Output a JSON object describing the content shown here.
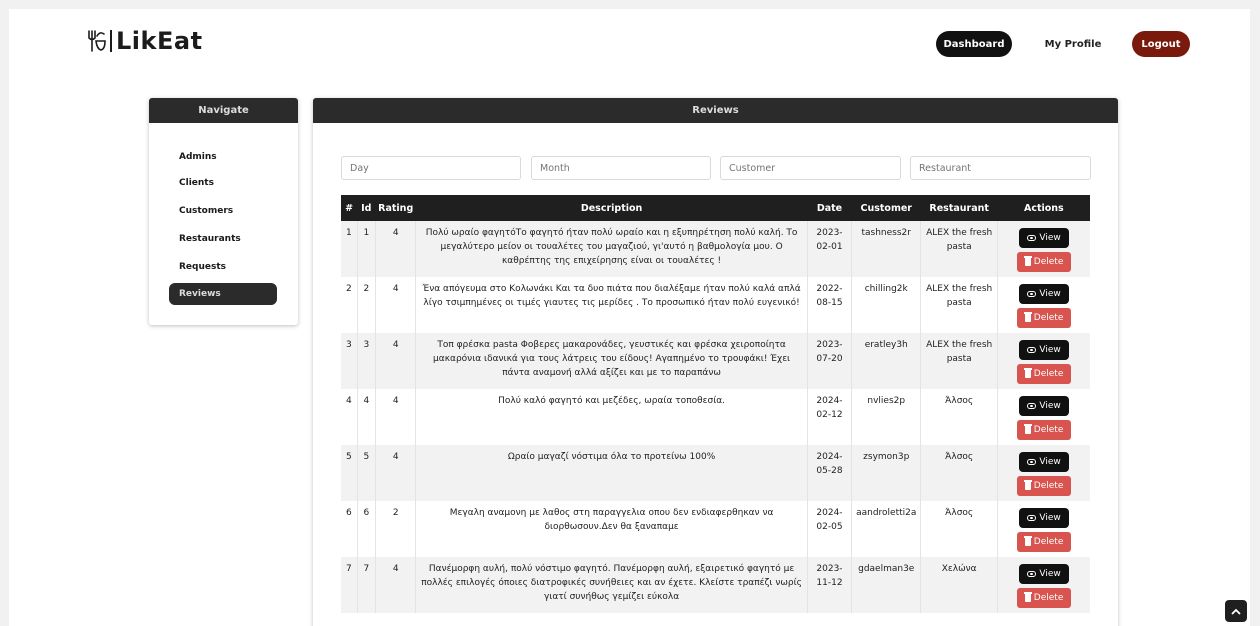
{
  "header": {
    "logo_text": "LikEat",
    "nav": {
      "dashboard": "Dashboard",
      "profile": "My Profile",
      "logout": "Logout"
    },
    "colors": {
      "dark": "#111111",
      "logout": "#7a1a0d"
    }
  },
  "sidebar": {
    "title": "Navigate",
    "items": [
      {
        "label": "Admins"
      },
      {
        "label": "Clients"
      },
      {
        "label": "Customers"
      },
      {
        "label": "Restaurants"
      },
      {
        "label": "Requests"
      },
      {
        "label": "Reviews",
        "active": true
      }
    ]
  },
  "reviews": {
    "title": "Reviews",
    "filters": {
      "day": "Day",
      "month": "Month",
      "customer": "Customer",
      "restaurant": "Restaurant"
    },
    "columns": [
      "#",
      "Id",
      "Rating",
      "Description",
      "Date",
      "Customer",
      "Restaurant",
      "Actions"
    ],
    "view_label": "View",
    "delete_label": "Delete",
    "rows": [
      {
        "n": "1",
        "id": "1",
        "rating": "4",
        "desc": "Πολύ ωραίο φαγητόΤο φαγητό ήταν πολύ ωραίο και η εξυπηρέτηση πολύ καλή. Το μεγαλύτερο μείον οι τουαλέτες του μαγαζιού, γι'αυτό η βαθμολογία μου. Ο καθρέπτης της επιχείρησης είναι οι τουαλέτες !",
        "date": "2023-02-01",
        "customer": "tashness2r",
        "restaurant": "ALEX the fresh pasta"
      },
      {
        "n": "2",
        "id": "2",
        "rating": "4",
        "desc": "Ένα απόγευμα στο Κολωνάκι Και τα δυο πιάτα που διαλέξαμε ήταν πολύ καλά απλά λίγο τσιμπημένες οι τιμές γιαυτες τις μερίδες . Το προσωπικό ήταν πολύ ευγενικό!",
        "date": "2022-08-15",
        "customer": "chilling2k",
        "restaurant": "ALEX the fresh pasta"
      },
      {
        "n": "3",
        "id": "3",
        "rating": "4",
        "desc": "Τοπ φρέσκα pasta Φοβερες μακαρονάδες, γευστικές και φρέσκα χειροποίητα μακαρόνια ιδανικά για τους λάτρεις του είδους! Αγαπημένο το τρουφάκι! Έχει πάντα αναμονή αλλά αξίζει και με το παραπάνω",
        "date": "2023-07-20",
        "customer": "eratley3h",
        "restaurant": "ALEX the fresh pasta"
      },
      {
        "n": "4",
        "id": "4",
        "rating": "4",
        "desc": "Πολύ καλό φαγητό και μεζέδες, ωραία τοποθεσία.",
        "date": "2024-02-12",
        "customer": "nvlies2p",
        "restaurant": "Άλσος"
      },
      {
        "n": "5",
        "id": "5",
        "rating": "4",
        "desc": "Ωραίο μαγαζί νόστιμα όλα το προτείνω 100%",
        "date": "2024-05-28",
        "customer": "zsymon3p",
        "restaurant": "Άλσος"
      },
      {
        "n": "6",
        "id": "6",
        "rating": "2",
        "desc": "Μεγαλη αναμονη με λαθος στη παραγγελια οπου δεν ενδιαφερθηκαν να διορθωσουν.Δεν θα ξαναπαμε",
        "date": "2024-02-05",
        "customer": "aandroletti2a",
        "restaurant": "Άλσος"
      },
      {
        "n": "7",
        "id": "7",
        "rating": "4",
        "desc": "Πανέμορφη αυλή, πολύ νόστιμο φαγητό. Πανέμορφη αυλή, εξαιρετικό φαγητό με πολλές επιλογές όποιες διατροφικές συνήθειες και αν έχετε. Κλείστε τραπέζι νωρίς γιατί συνήθως γεμίζει εύκολα",
        "date": "2023-11-12",
        "customer": "gdaelman3e",
        "restaurant": "Χελώνα"
      }
    ]
  },
  "scroll_top_icon": "chevron-up-icon"
}
